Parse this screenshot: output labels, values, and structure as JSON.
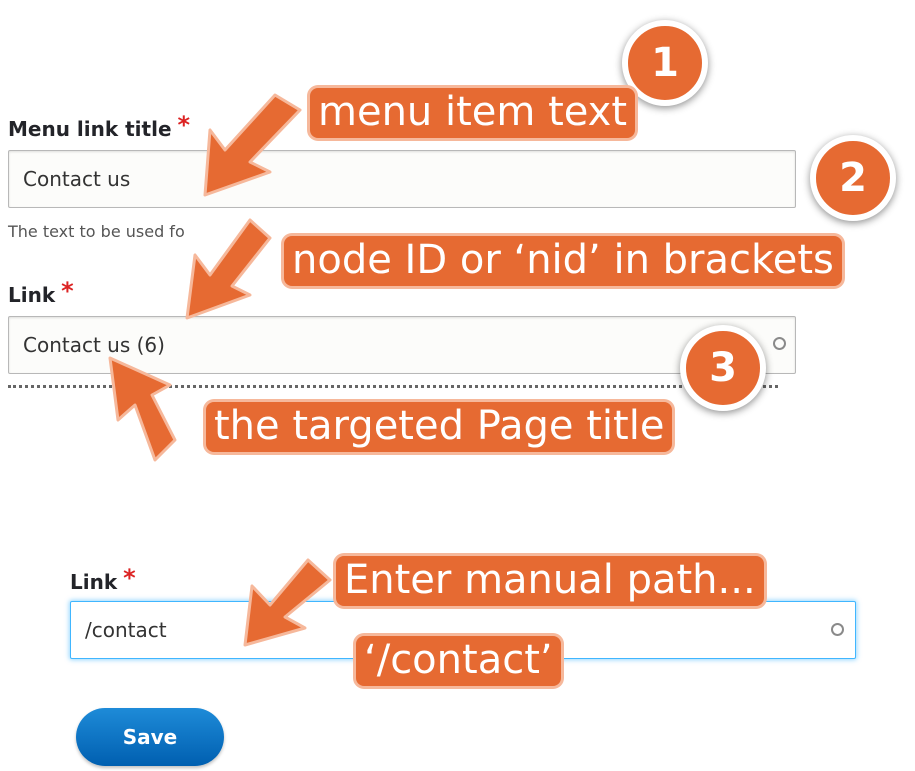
{
  "form": {
    "menu_link_title": {
      "label": "Menu link title",
      "required_mark": "*",
      "value": "Contact us",
      "description": "The text to be used fo"
    },
    "link": {
      "label": "Link",
      "required_mark": "*",
      "value": "Contact us (6)"
    }
  },
  "manual_form": {
    "link": {
      "label": "Link",
      "required_mark": "*",
      "value": "/contact"
    },
    "save_label": "Save"
  },
  "annotations": {
    "badge_1": "1",
    "badge_2": "2",
    "badge_3": "3",
    "callout_menu_item": "menu item text",
    "callout_node_id": "node ID or ‘nid’ in brackets",
    "callout_page_title": "the targeted Page title",
    "callout_manual_path_line1": "Enter manual path...",
    "callout_manual_path_line2": "‘/contact’"
  },
  "colors": {
    "annotation": "#e66a32",
    "required": "#dc2323",
    "button": "#0a6fc2",
    "focus": "#40b6ff"
  }
}
